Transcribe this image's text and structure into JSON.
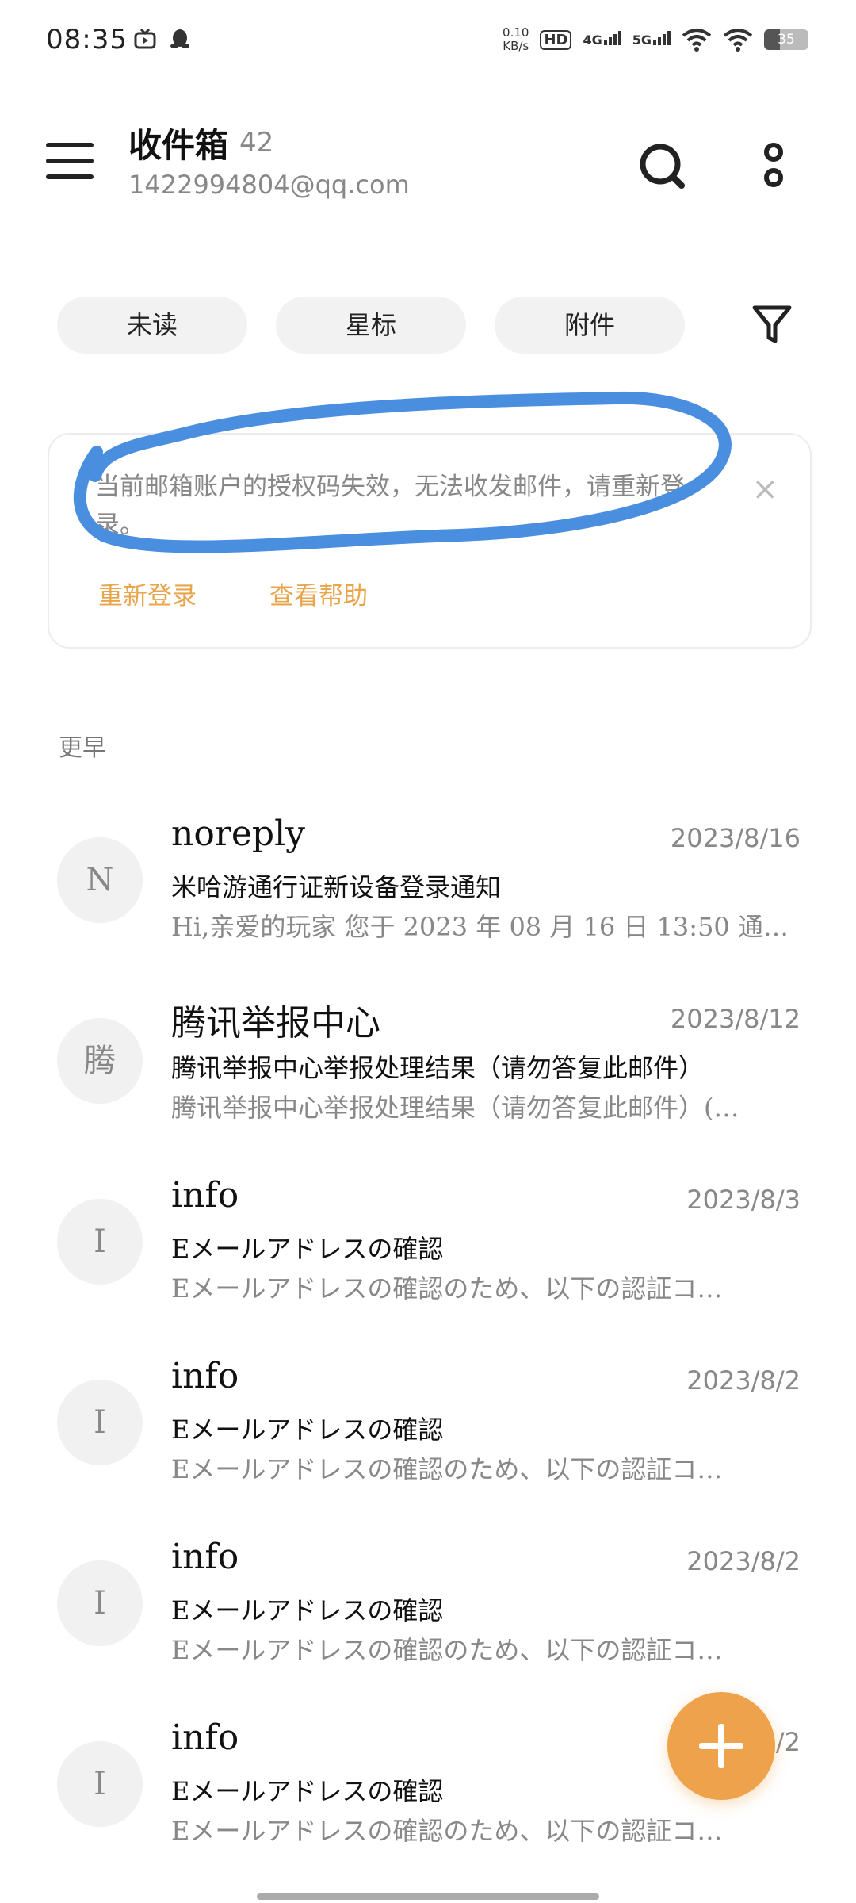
{
  "status_bar": {
    "time": "08:35",
    "net_speed_value": "0.10",
    "net_speed_unit": "KB/s",
    "hd_badge": "HD",
    "network_1": "4G",
    "network_2": "5G",
    "battery": "35"
  },
  "header": {
    "title": "收件箱",
    "count": "42",
    "email": "1422994804@qq.com"
  },
  "filters": [
    {
      "label": "未读"
    },
    {
      "label": "星标"
    },
    {
      "label": "附件"
    }
  ],
  "notice": {
    "message": "当前邮箱账户的授权码失效，无法收发邮件，请重新登录。",
    "relogin_label": "重新登录",
    "help_label": "查看帮助",
    "close_symbol": "×",
    "annotation_color": "#4a8ee0"
  },
  "section_label": "更早",
  "mails": [
    {
      "avatar": "N",
      "sender": "noreply",
      "date": "2023/8/16",
      "subject": "米哈游通行证新设备登录通知",
      "preview": "Hi,亲爱的玩家 您于 2023 年 08 月 16 日 13:50 通…"
    },
    {
      "avatar": "腾",
      "sender": "腾讯举报中心",
      "date": "2023/8/12",
      "subject": "腾讯举报中心举报处理结果（请勿答复此邮件）",
      "preview": "腾讯举报中心举报处理结果（请勿答复此邮件）(…"
    },
    {
      "avatar": "I",
      "sender": "info",
      "date": "2023/8/3",
      "subject": "Eメールアドレスの確認",
      "preview": "Eメールアドレスの確認のため、以下の認証コ…"
    },
    {
      "avatar": "I",
      "sender": "info",
      "date": "2023/8/2",
      "subject": "Eメールアドレスの確認",
      "preview": "Eメールアドレスの確認のため、以下の認証コ…"
    },
    {
      "avatar": "I",
      "sender": "info",
      "date": "2023/8/2",
      "subject": "Eメールアドレスの確認",
      "preview": "Eメールアドレスの確認のため、以下の認証コ…"
    },
    {
      "avatar": "I",
      "sender": "info",
      "date": "2023/8/2",
      "subject": "Eメールアドレスの確認",
      "preview": "Eメールアドレスの確認のため、以下の認証コ…"
    }
  ],
  "colors": {
    "accent": "#e8a54c",
    "fab": "#eea24b"
  }
}
